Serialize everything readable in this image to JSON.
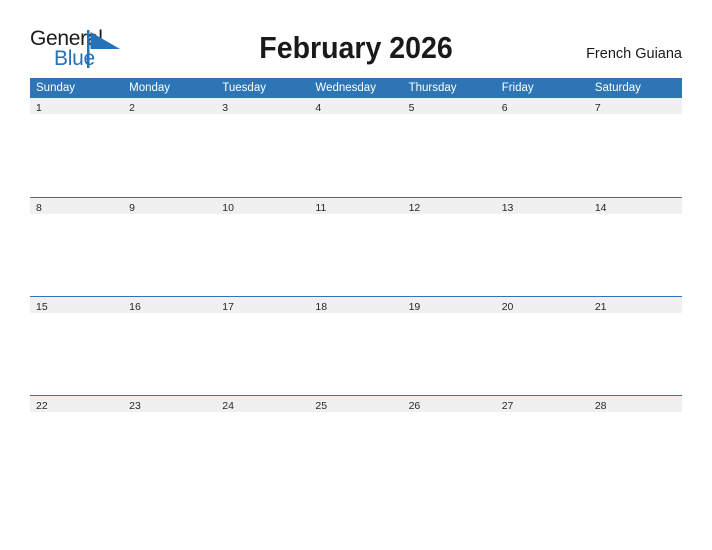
{
  "branding": {
    "logo_text_primary": "General",
    "logo_text_secondary": "Blue",
    "logo_flag_icon": "blue-flag-triangle-icon",
    "primary_color": "#2e75b6",
    "logo_blue": "#2572b8",
    "header_text_color": "#ffffff",
    "daynum_band_color": "#f0f0f0"
  },
  "header": {
    "title": "February 2026",
    "month": "February",
    "year": "2026",
    "locale": "French Guiana"
  },
  "calendar": {
    "weekday_headers": [
      "Sunday",
      "Monday",
      "Tuesday",
      "Wednesday",
      "Thursday",
      "Friday",
      "Saturday"
    ],
    "weeks": [
      {
        "days": [
          {
            "number": "1"
          },
          {
            "number": "2"
          },
          {
            "number": "3"
          },
          {
            "number": "4"
          },
          {
            "number": "5"
          },
          {
            "number": "6"
          },
          {
            "number": "7"
          }
        ]
      },
      {
        "days": [
          {
            "number": "8"
          },
          {
            "number": "9"
          },
          {
            "number": "10"
          },
          {
            "number": "11"
          },
          {
            "number": "12"
          },
          {
            "number": "13"
          },
          {
            "number": "14"
          }
        ]
      },
      {
        "days": [
          {
            "number": "15"
          },
          {
            "number": "16"
          },
          {
            "number": "17"
          },
          {
            "number": "18"
          },
          {
            "number": "19"
          },
          {
            "number": "20"
          },
          {
            "number": "21"
          }
        ]
      },
      {
        "days": [
          {
            "number": "22"
          },
          {
            "number": "23"
          },
          {
            "number": "24"
          },
          {
            "number": "25"
          },
          {
            "number": "26"
          },
          {
            "number": "27"
          },
          {
            "number": "28"
          }
        ]
      }
    ]
  }
}
